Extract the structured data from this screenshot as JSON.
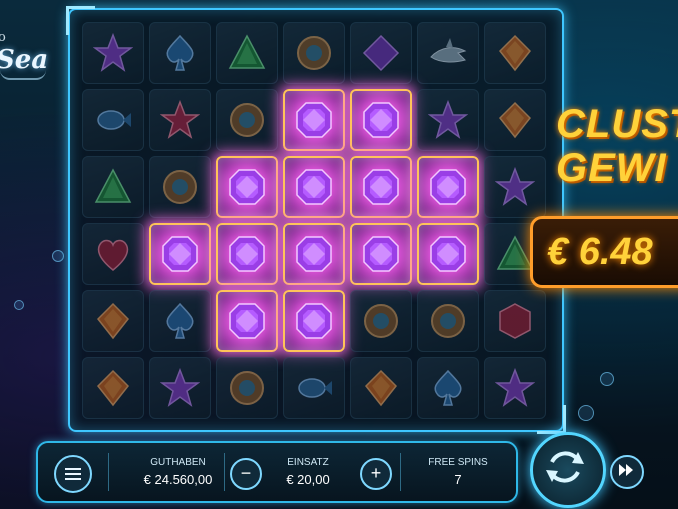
{
  "logo": {
    "line1": "o",
    "line2": "Sea"
  },
  "promo": {
    "title_line1": "CLUST",
    "title_line2": "GEWI",
    "win_amount": "€ 6.48"
  },
  "colors": {
    "frame": "#3fc7ff",
    "win_glow": "#ff6ee6",
    "gold": "#ffd23a"
  },
  "grid": {
    "rows": [
      [
        "purple-star-gem",
        "blue-spade-gem",
        "green-triangle-gem",
        "bronze-medallion",
        "purple-square-gem",
        "shark",
        "orange-diamond-gem"
      ],
      [
        "blue-fish",
        "red-star-gem",
        "bronze-medallion",
        "purple-octagon-gem",
        "purple-octagon-gem",
        "purple-star-gem",
        "orange-diamond-gem"
      ],
      [
        "green-triangle-gem",
        "bronze-medallion",
        "purple-octagon-gem",
        "purple-octagon-gem",
        "purple-octagon-gem",
        "purple-octagon-gem",
        "purple-star-gem"
      ],
      [
        "red-heart-gem",
        "purple-octagon-gem",
        "purple-octagon-gem",
        "purple-octagon-gem",
        "purple-octagon-gem",
        "purple-octagon-gem",
        "green-triangle-gem"
      ],
      [
        "orange-diamond-gem",
        "blue-spade-gem",
        "purple-octagon-gem",
        "purple-octagon-gem",
        "bronze-medallion",
        "bronze-medallion",
        "red-hex-gem"
      ],
      [
        "orange-diamond-gem",
        "purple-star-gem",
        "bronze-medallion",
        "blue-fish",
        "orange-diamond-gem",
        "blue-spade-gem",
        "purple-star-gem"
      ]
    ],
    "win_cells": [
      [
        1,
        3
      ],
      [
        1,
        4
      ],
      [
        2,
        2
      ],
      [
        2,
        3
      ],
      [
        2,
        4
      ],
      [
        2,
        5
      ],
      [
        3,
        1
      ],
      [
        3,
        2
      ],
      [
        3,
        3
      ],
      [
        3,
        4
      ],
      [
        3,
        5
      ],
      [
        4,
        2
      ],
      [
        4,
        3
      ]
    ]
  },
  "bar": {
    "balance_label": "GUTHABEN",
    "balance_value": "€ 24.560,00",
    "bet_label": "EINSATZ",
    "bet_value": "€ 20,00",
    "freespins_label": "FREE SPINS",
    "freespins_value": "7",
    "minus": "−",
    "plus": "+"
  }
}
